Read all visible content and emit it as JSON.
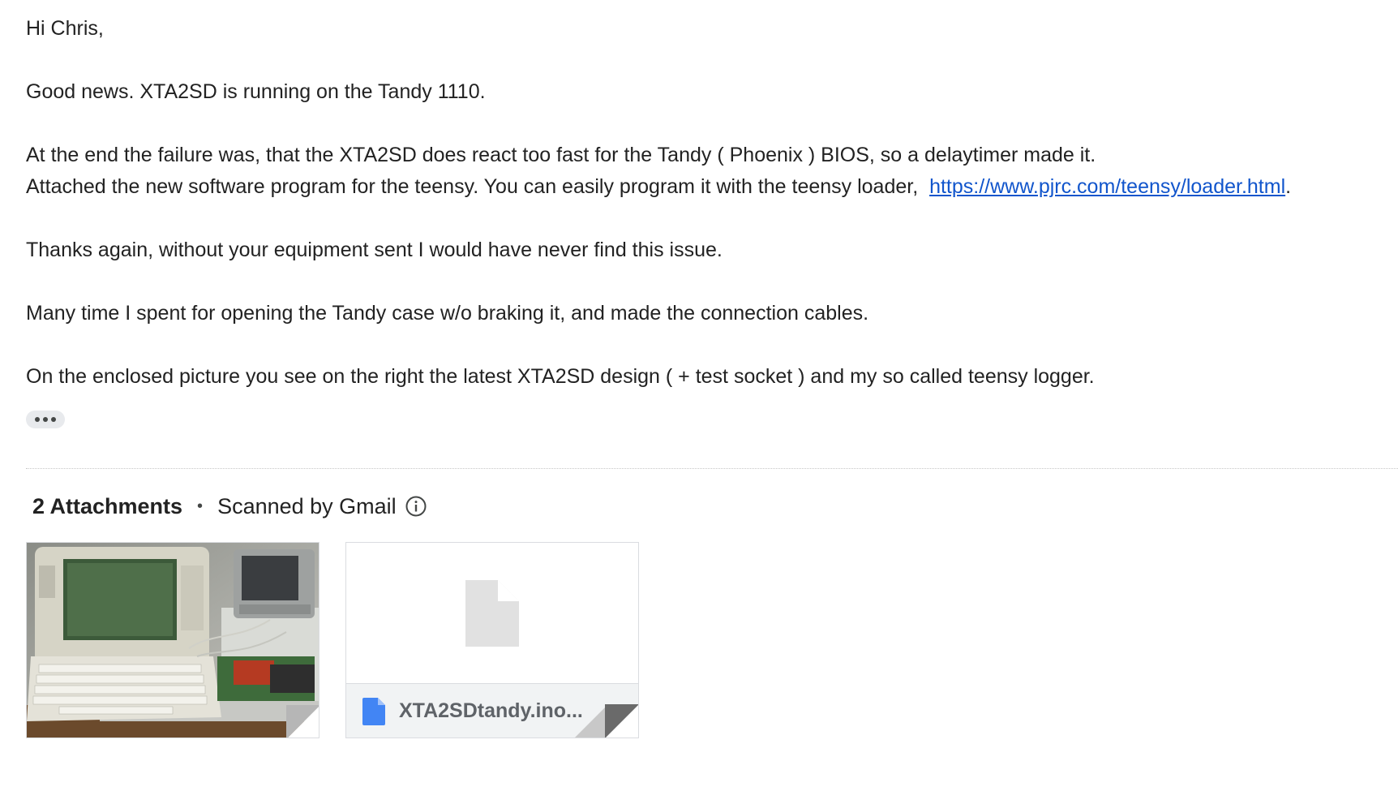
{
  "email": {
    "greeting": "Hi Chris,",
    "p1": "Good news. XTA2SD is running on the Tandy 1110.",
    "p2_line1": "At the end the failure was, that the XTA2SD does react too fast for the Tandy ( Phoenix ) BIOS, so a delaytimer made it.",
    "p2_line2_prefix": "Attached the new software program for the teensy. You can easily program it with the teensy loader,  ",
    "p2_link": "https://www.pjrc.com/teensy/loader.html",
    "p2_line2_suffix": ".",
    "p3": "Thanks again, without your equipment sent I would have never find this issue.",
    "p4": "Many time I spent for opening the Tandy case w/o braking it, and made the connection cables.",
    "p5": "On the enclosed picture you see on the right the latest XTA2SD design ( + test socket ) and my so called teensy logger."
  },
  "attachments": {
    "count_label": "2 Attachments",
    "bullet": "•",
    "scanned_label": "Scanned by Gmail",
    "items": [
      {
        "type": "image",
        "icon": "photo-thumbnail"
      },
      {
        "type": "file",
        "name": "XTA2SDtandy.ino...",
        "icon": "document-icon"
      }
    ]
  },
  "colors": {
    "link": "#1155cc",
    "file_icon": "#4285f4",
    "chip_bg": "#e8eaed"
  }
}
